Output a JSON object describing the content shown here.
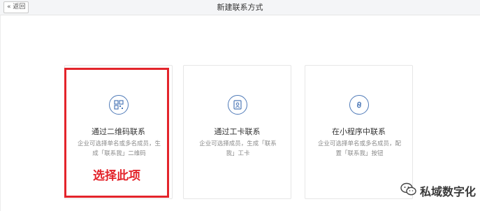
{
  "header": {
    "back_label": "« 返回",
    "title": "新建联系方式"
  },
  "cards": [
    {
      "icon": "qrcode-icon",
      "title": "通过二维码联系",
      "desc": "企业可选择单名或多名成员，生成「联系我」二维码"
    },
    {
      "icon": "badge-card-icon",
      "title": "通过工卡联系",
      "desc": "企业可选择成员，生成「联系我」工卡"
    },
    {
      "icon": "mini-program-icon",
      "title": "在小程序中联系",
      "desc": "企业可选择单名或多名成员，配置「联系我」按钮"
    }
  ],
  "annotation": {
    "callout": "选择此项",
    "highlight_color": "#e3242b"
  },
  "watermark": {
    "text": "私域数字化",
    "icon": "wechat-logo-icon"
  },
  "colors": {
    "accent": "#4f7ab8"
  }
}
